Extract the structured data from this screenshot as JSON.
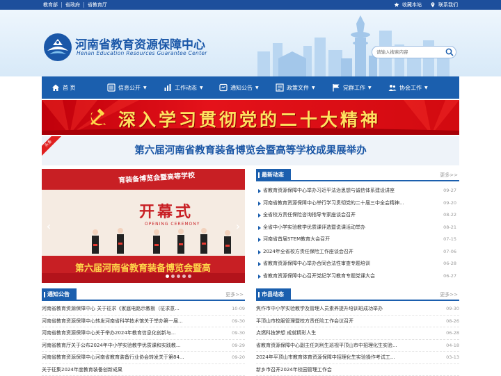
{
  "topbar": {
    "links": [
      "教育部",
      "省政府",
      "省教育厅"
    ],
    "favorite_label": "收藏本站",
    "contact_label": "联系我们"
  },
  "header": {
    "site_title": "河南省教育资源保障中心",
    "site_subtitle": "Henan Education Resources Guarantee Center",
    "search_placeholder": "请输入搜索内容"
  },
  "nav": {
    "items": [
      {
        "label": "首 页",
        "icon": "home-icon",
        "dropdown": false
      },
      {
        "label": "信息公开",
        "icon": "list-icon",
        "dropdown": true
      },
      {
        "label": "工作动态",
        "icon": "bar-chart-icon",
        "dropdown": true
      },
      {
        "label": "通知公告",
        "icon": "notice-icon",
        "dropdown": true
      },
      {
        "label": "政策文件",
        "icon": "document-icon",
        "dropdown": true
      },
      {
        "label": "党群工作",
        "icon": "flag-icon",
        "dropdown": true
      },
      {
        "label": "协会工作",
        "icon": "people-icon",
        "dropdown": true
      }
    ]
  },
  "banner": {
    "text": "深入学习贯彻党的二十大精神"
  },
  "headline": {
    "tag": "头条",
    "title": "第六届河南省教育装备博览会暨高等学校成果展举办"
  },
  "slider": {
    "sign_text": "开幕式",
    "sign_sub": "OPENING CEREMONY",
    "backdrop_text": "第六届河南省教育装备博览会暨高",
    "top_text": "育装备博览会暨高等学校",
    "dot_count": 5
  },
  "news": {
    "title": "最新动态",
    "more": "更多>>",
    "items": [
      {
        "text": "省教育资源保障中心举办习近平法治思想与诚信体系建设讲座",
        "date": "09-27"
      },
      {
        "text": "河南省教育资源保障中心举行学习贯彻党的二十届三中全会精神...",
        "date": "09-20"
      },
      {
        "text": "全省校方责任保险咨询指导专家座谈会召开",
        "date": "08-22"
      },
      {
        "text": "全省中小学实验教学优质课评选暨说课活动举办",
        "date": "08-21"
      },
      {
        "text": "河南省首届STEM教育大会召开",
        "date": "07-15"
      },
      {
        "text": "2024年全省校方责任保险工作座谈会召开",
        "date": "07-06"
      },
      {
        "text": "省教育资源保障中心举办合同合法性审查专题培训",
        "date": "06-28"
      },
      {
        "text": "省教育资源保障中心召开党纪学习教育专题党课大会",
        "date": "06-27"
      }
    ]
  },
  "notices": {
    "title": "通知公告",
    "more": "更多>>",
    "items": [
      {
        "text": "河南省教育资源保障中心 关于征求《家庭电路示教板（征求意...",
        "date": "10-09"
      },
      {
        "text": "河南省教育资源保障中心转发河南省科学技术馆关于举办第一届...",
        "date": "09-30"
      },
      {
        "text": "河南省教育资源保障中心关于举办2024年教育信息化创新与...",
        "date": "09-30"
      },
      {
        "text": "河南省教育厅关于公布2024年中小学实验教学优质课和实践教...",
        "date": "09-29"
      },
      {
        "text": "河南省教育资源保障中心河南省教育装备行业协会转发关于第84...",
        "date": "09-20"
      },
      {
        "text": "关于征集2024年度教育装备创新成果",
        "date": ""
      }
    ]
  },
  "counties": {
    "title": "市县动态",
    "more": "更多>>",
    "items": [
      {
        "text": "焦作市中小学实验教学及管理人员素养提升培训班成功举办",
        "date": "09-30"
      },
      {
        "text": "平顶山市校服管理暨校方责任险工作会议召开",
        "date": "08-26"
      },
      {
        "text": "点燃科技梦想 成就精彩人生",
        "date": "06-28"
      },
      {
        "text": "省教育资源保障中心副主任刘利生巡视平顶山市中招理化生实验...",
        "date": "04-18"
      },
      {
        "text": "2024年平顶山市教育体育资源保障中招理化生实验操作考试工...",
        "date": "03-13"
      },
      {
        "text": "新乡市召开2024年校园管理工作会",
        "date": ""
      }
    ]
  },
  "colors": {
    "primary": "#1b5fae",
    "topbar": "#1d4f9c",
    "banner_red": "#d60a12",
    "banner_text": "#ffe160"
  }
}
